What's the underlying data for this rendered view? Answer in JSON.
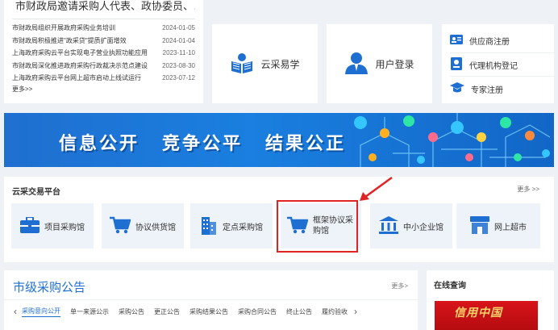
{
  "news": {
    "headline": "市财政局邀请采购人代表、政协委员、…",
    "items": [
      {
        "title": "市财政局组织开展政府采购业务培训",
        "date": "2024-01-05"
      },
      {
        "title": "市财政局积极推进\"政采贷\"提质扩面增效",
        "date": "2024-01-04"
      },
      {
        "title": "上海政府采购云平台实现电子营业执照功能应用",
        "date": "2023-11-10"
      },
      {
        "title": "市财政局深化推进政府采购行政裁决示范点建设",
        "date": "2023-08-30"
      },
      {
        "title": "上海政府采购云平台网上超市启动上线试运行",
        "date": "2023-07-12"
      }
    ],
    "more": "更多>>"
  },
  "quick": {
    "learn_label": "云采易学",
    "login_label": "用户登录"
  },
  "register": {
    "supplier": "供应商注册",
    "agency": "代理机构登记",
    "expert": "专家注册"
  },
  "banner": {
    "slogans": [
      "信息公开",
      "竞争公平",
      "结果公正"
    ]
  },
  "platform": {
    "title": "云采交易平台",
    "more": "更多 >>",
    "tiles": [
      "项目采购馆",
      "协议供货馆",
      "定点采购馆",
      "框架协议采购馆",
      "中小企业馆",
      "网上超市"
    ]
  },
  "announce": {
    "title": "市级采购公告",
    "more": "更多>",
    "tabs": [
      "采购意向公开",
      "单一来源公示",
      "采购公告",
      "更正公告",
      "采购结果公告",
      "采购合同公告",
      "终止公告",
      "履约验收"
    ]
  },
  "online": {
    "title": "在线查询",
    "image_logo": "信用中国"
  },
  "colors": {
    "accent": "#1e6fd1",
    "highlight": "#e02424",
    "banner": "#1a7fe0"
  }
}
